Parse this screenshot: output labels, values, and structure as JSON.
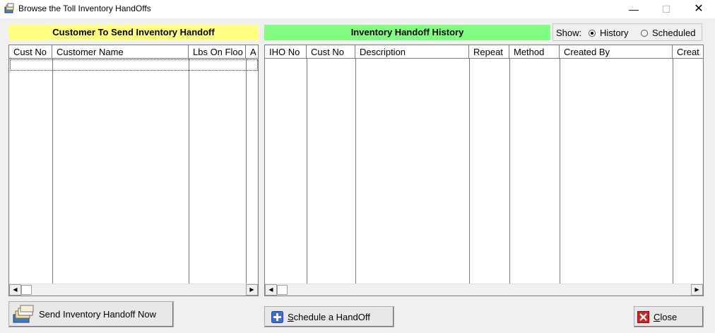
{
  "window": {
    "title": "Browse the Toll Inventory HandOffs",
    "minimize_glyph": "—",
    "maximize_glyph": "☐",
    "close_glyph": "✕"
  },
  "left_panel": {
    "header": "Customer To Send Inventory Handoff",
    "header_color": "#ffff80",
    "columns": [
      "Cust No",
      "Customer Name",
      "Lbs On Floo",
      "A"
    ],
    "rows": []
  },
  "right_panel": {
    "header": "Inventory Handoff History",
    "header_color": "#80ff80",
    "columns": [
      "IHO No",
      "Cust No",
      "Description",
      "Repeat",
      "Method",
      "Created By",
      "Creat"
    ],
    "rows": []
  },
  "show": {
    "label": "Show:",
    "options": [
      "History",
      "Scheduled"
    ],
    "selected": "History"
  },
  "buttons": {
    "send": {
      "label": "Send Inventory Handoff Now",
      "icon": "stack-cards-icon"
    },
    "schedule": {
      "label_underlined": "S",
      "label_rest": "chedule a HandOff",
      "icon": "plus-icon"
    },
    "close": {
      "label_underlined": "C",
      "label_rest": "lose",
      "icon": "red-x-icon"
    }
  },
  "scroll": {
    "left_arrow": "◀",
    "right_arrow": "▶"
  }
}
